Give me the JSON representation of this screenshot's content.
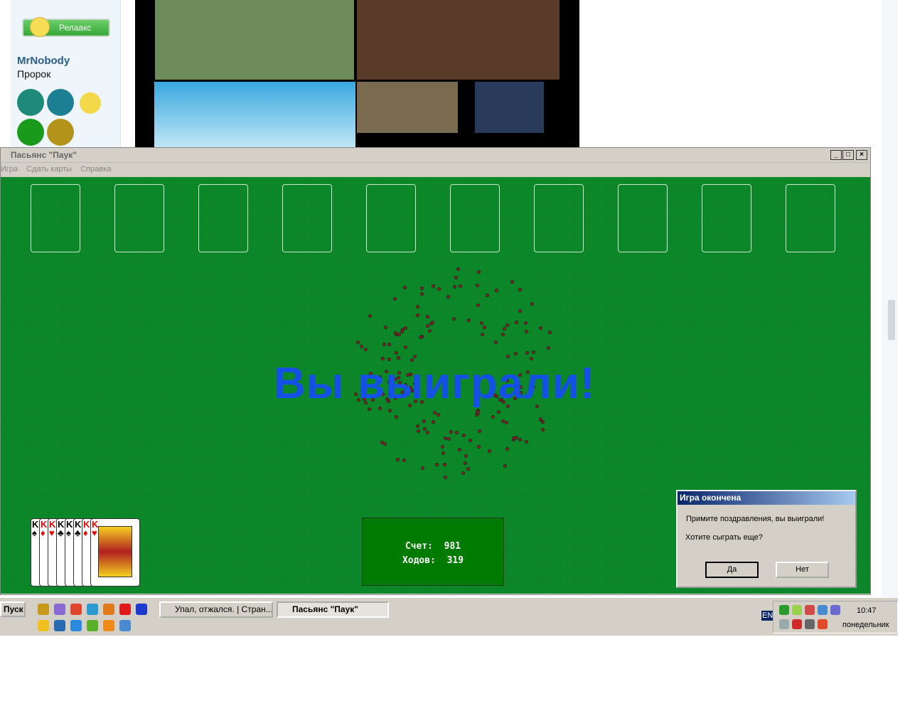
{
  "browser": {
    "relax_button": "Релаакс",
    "username": "MrNobody",
    "rank": "Пророк"
  },
  "window": {
    "title": "Пасьянс \"Паук\"",
    "menu": [
      "Игра",
      "Сдать карты",
      "Справка"
    ],
    "controls": [
      "_",
      "□",
      "×"
    ]
  },
  "game": {
    "win_message": "Вы выиграли!",
    "score_label": "Счет:",
    "score": "981",
    "moves_label": "Ходов:",
    "moves": "319",
    "completed_suits": [
      {
        "rank": "K",
        "suit": "♠",
        "color": "#000"
      },
      {
        "rank": "K",
        "suit": "♦",
        "color": "#e00"
      },
      {
        "rank": "K",
        "suit": "♥",
        "color": "#e00"
      },
      {
        "rank": "K",
        "suit": "♣",
        "color": "#000"
      },
      {
        "rank": "K",
        "suit": "♠",
        "color": "#000"
      },
      {
        "rank": "K",
        "suit": "♣",
        "color": "#000"
      },
      {
        "rank": "K",
        "suit": "♦",
        "color": "#e00"
      },
      {
        "rank": "K",
        "suit": "♥",
        "color": "#e00"
      }
    ]
  },
  "dialog": {
    "title": "Игра окончена",
    "line1": "Примите поздравления, вы выиграли!",
    "line2": "Хотите сыграть еще?",
    "yes": "Да",
    "no": "Нет"
  },
  "taskbar": {
    "start": "Пуск",
    "tasks": [
      "Упал, отжался. | Стран...",
      "Пасьянс \"Паук\""
    ],
    "lang": "EN",
    "time": "10:47",
    "day": "понедельник"
  }
}
